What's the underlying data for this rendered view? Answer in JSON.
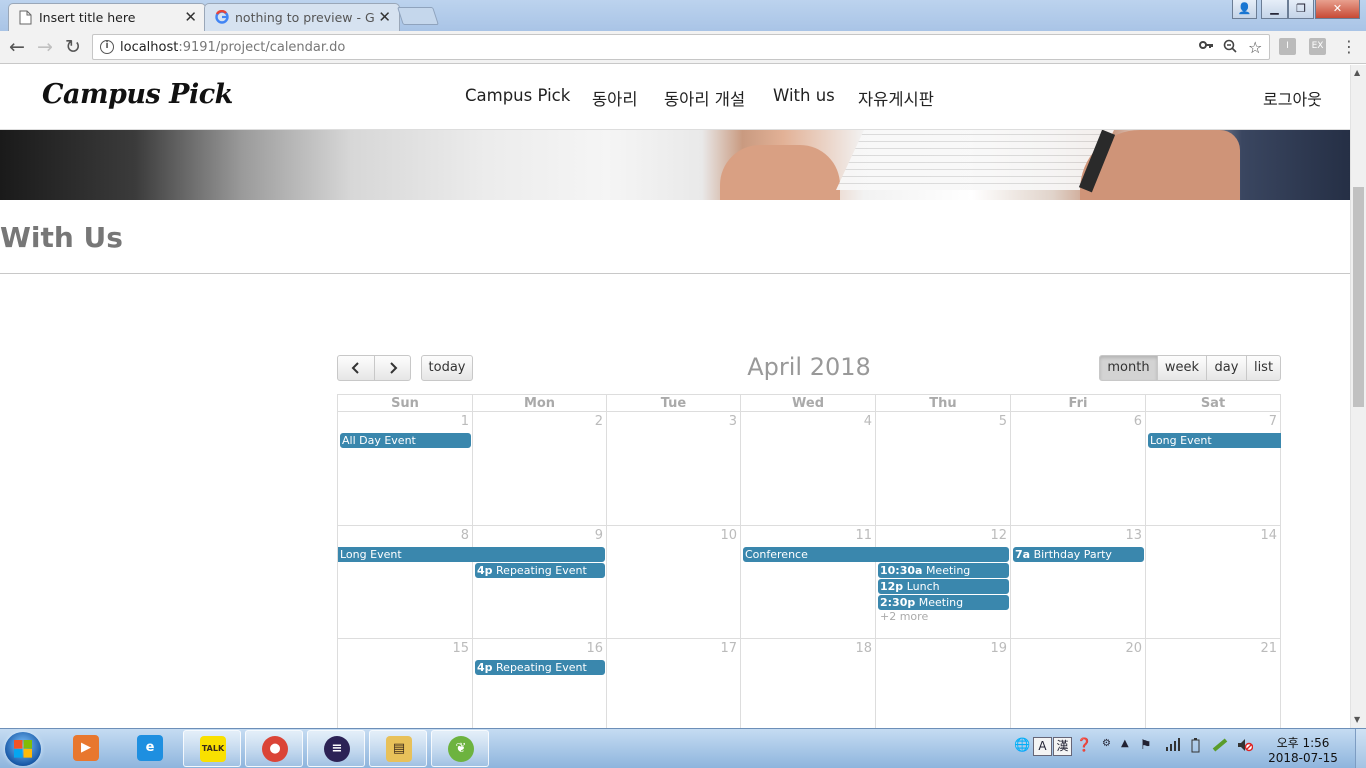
{
  "browser": {
    "tabs": [
      {
        "title": "Insert title here",
        "icon": "page-icon",
        "active": true
      },
      {
        "title": "nothing to preview - Go",
        "icon": "google-icon",
        "active": false
      }
    ],
    "address": {
      "host": "localhost",
      "rest": ":9191/project/calendar.do"
    },
    "omnibox_icons": [
      "key-icon",
      "zoom-icon",
      "star-icon"
    ],
    "extensions": [
      "I",
      "EX"
    ]
  },
  "site": {
    "logo": "Campus Pick",
    "nav": [
      "Campus Pick",
      "동아리",
      "동아리 개설",
      "With us",
      "자유게시판"
    ],
    "logout": "로그아웃",
    "section_title": "With Us"
  },
  "calendar": {
    "title": "April 2018",
    "today_label": "today",
    "views": [
      {
        "label": "month",
        "active": true
      },
      {
        "label": "week",
        "active": false
      },
      {
        "label": "day",
        "active": false
      },
      {
        "label": "list",
        "active": false
      }
    ],
    "dow": [
      "Sun",
      "Mon",
      "Tue",
      "Wed",
      "Thu",
      "Fri",
      "Sat"
    ],
    "weeks": [
      [
        1,
        2,
        3,
        4,
        5,
        6,
        7
      ],
      [
        8,
        9,
        10,
        11,
        12,
        13,
        14
      ],
      [
        15,
        16,
        17,
        18,
        19,
        20,
        21
      ]
    ],
    "events": [
      {
        "week": 0,
        "start": 0,
        "span": 1,
        "row": 0,
        "time": "",
        "title": "All Day Event"
      },
      {
        "week": 0,
        "start": 6,
        "span": 1,
        "row": 0,
        "time": "",
        "title": "Long Event",
        "continues": "right"
      },
      {
        "week": 1,
        "start": 0,
        "span": 2,
        "row": 0,
        "time": "",
        "title": "Long Event",
        "continues": "left"
      },
      {
        "week": 1,
        "start": 1,
        "span": 1,
        "row": 1,
        "time": "4p",
        "title": "Repeating Event"
      },
      {
        "week": 1,
        "start": 3,
        "span": 2,
        "row": 0,
        "time": "",
        "title": "Conference"
      },
      {
        "week": 1,
        "start": 4,
        "span": 1,
        "row": 1,
        "time": "10:30a",
        "title": "Meeting"
      },
      {
        "week": 1,
        "start": 4,
        "span": 1,
        "row": 2,
        "time": "12p",
        "title": "Lunch"
      },
      {
        "week": 1,
        "start": 4,
        "span": 1,
        "row": 3,
        "time": "2:30p",
        "title": "Meeting"
      },
      {
        "week": 1,
        "start": 5,
        "span": 1,
        "row": 0,
        "time": "7a",
        "title": "Birthday Party"
      },
      {
        "week": 2,
        "start": 1,
        "span": 1,
        "row": 0,
        "time": "4p",
        "title": "Repeating Event"
      }
    ],
    "more_links": [
      {
        "week": 1,
        "day": 4,
        "label": "+2 more"
      }
    ]
  },
  "taskbar": {
    "apps": [
      {
        "name": "media-player-icon",
        "label": "▶",
        "color": "#e8772e"
      },
      {
        "name": "ie-icon",
        "label": "e",
        "color": "#1e8fe0"
      },
      {
        "name": "kakaotalk-icon",
        "label": "TALK",
        "color": "#f9e000"
      },
      {
        "name": "chrome-icon",
        "label": "●",
        "color": "#db4437"
      },
      {
        "name": "eclipse-icon",
        "label": "≡",
        "color": "#2c2255"
      },
      {
        "name": "file-explorer-icon",
        "label": "▤",
        "color": "#e8c15a"
      },
      {
        "name": "spring-tool-suite-icon",
        "label": "❦",
        "color": "#6db33f"
      }
    ],
    "ime": [
      "A",
      "漢"
    ],
    "clock_time": "오후 1:56",
    "clock_date": "2018-07-15"
  }
}
